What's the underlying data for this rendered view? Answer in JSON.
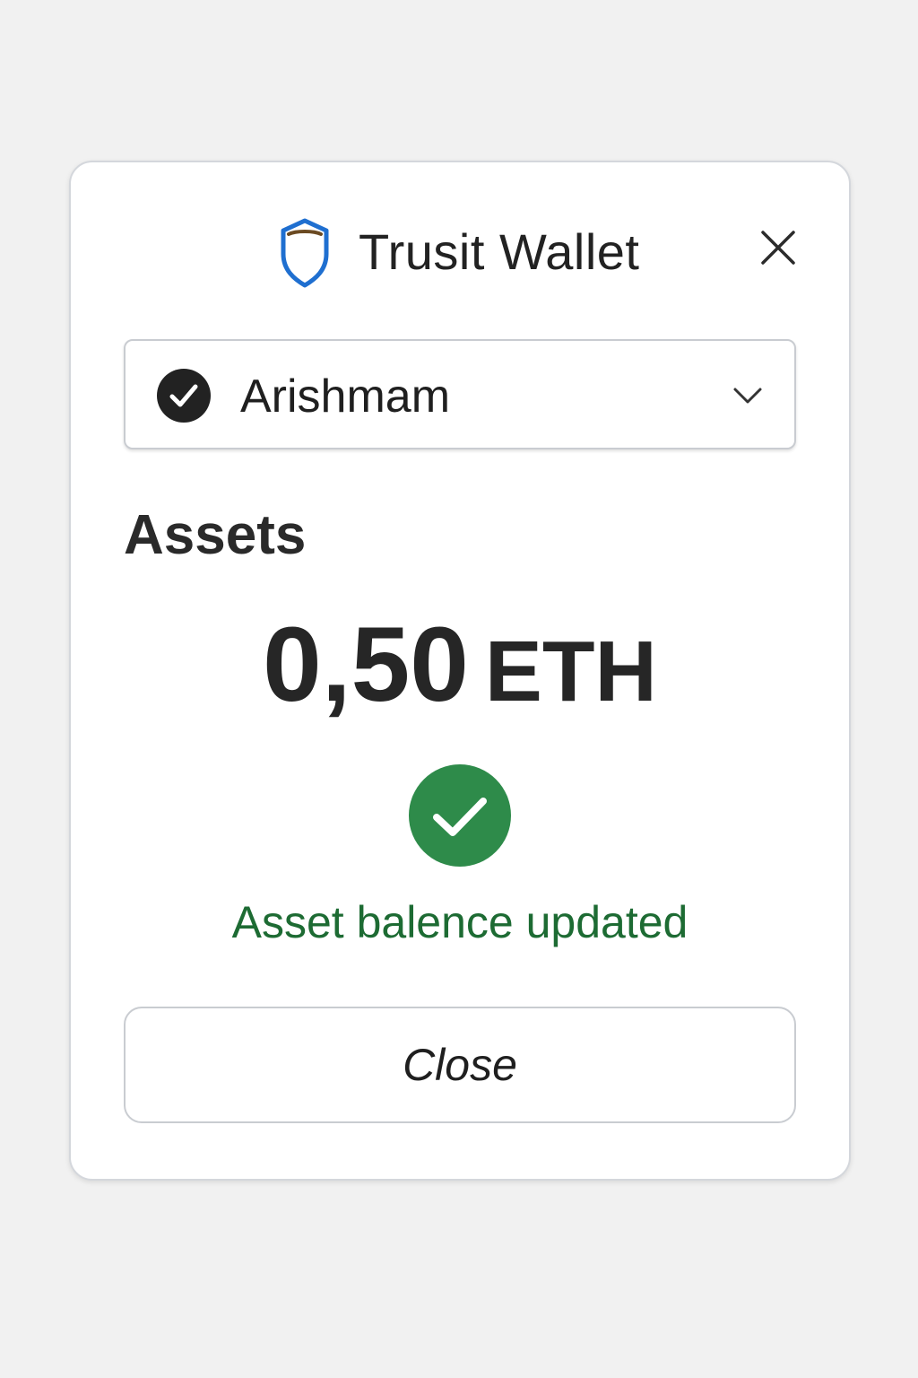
{
  "dialog": {
    "title": "Trusit Wallet",
    "logo_icon": "shield-icon",
    "close_icon": "close-icon"
  },
  "account": {
    "selected_name": "Arishmam",
    "selected_icon": "check-circle-icon",
    "dropdown_icon": "chevron-down-icon"
  },
  "assets": {
    "heading": "Assets",
    "balance_amount": "0,50",
    "balance_unit": "ETH"
  },
  "status": {
    "icon": "success-check-icon",
    "message": "Asset balence updated"
  },
  "actions": {
    "close_label": "Close"
  },
  "colors": {
    "shield_blue": "#1f6fd0",
    "success_green": "#2e8b4a",
    "status_text_green": "#1d6b33"
  }
}
